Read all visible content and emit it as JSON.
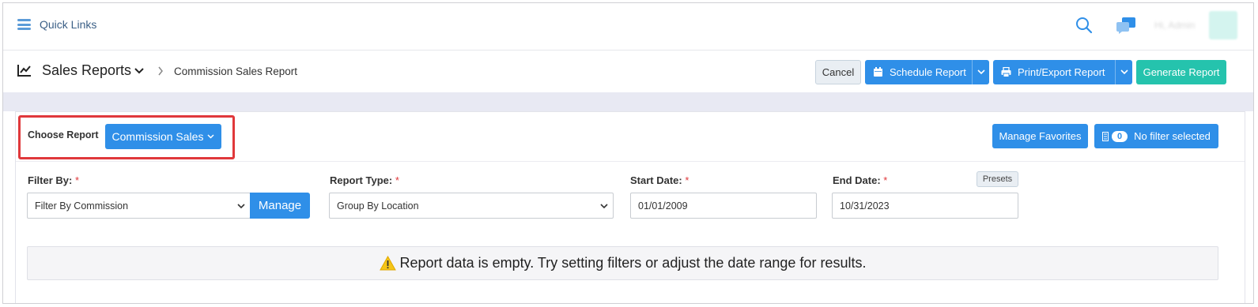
{
  "topbar": {
    "quick_links": "Quick Links",
    "user_name": "Hi, Admin"
  },
  "header": {
    "title": "Sales Reports",
    "breadcrumb": "Commission Sales Report",
    "cancel_label": "Cancel",
    "schedule_label": "Schedule Report",
    "print_label": "Print/Export Report",
    "generate_label": "Generate Report"
  },
  "report": {
    "choose_label": "Choose Report",
    "choose_value": "Commission Sales",
    "manage_favorites": "Manage Favorites",
    "filter_count": "0",
    "filter_status": "No filter selected"
  },
  "filters": {
    "filter_by_label": "Filter By:",
    "filter_by_value": "Filter By Commission",
    "manage_label": "Manage",
    "report_type_label": "Report Type:",
    "report_type_value": "Group By Location",
    "start_date_label": "Start Date:",
    "start_date_value": "01/01/2009",
    "end_date_label": "End Date:",
    "end_date_value": "10/31/2023",
    "presets_label": "Presets",
    "required_mark": "*"
  },
  "empty_message": "Report data is empty. Try setting filters or adjust the date range for results.",
  "colors": {
    "primary": "#2f8fe8",
    "success": "#25c3ad",
    "highlight": "#e0383b",
    "warning": "#f5c518"
  },
  "icons": [
    "hamburger-icon",
    "search-icon",
    "chat-icon",
    "chart-icon",
    "chevron-down-icon",
    "chevron-right-icon",
    "calendar-icon",
    "printer-icon",
    "filter-icon",
    "warning-icon"
  ]
}
